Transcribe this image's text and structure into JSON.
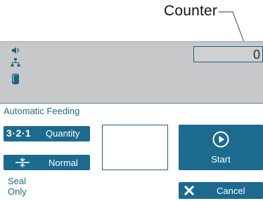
{
  "callout": {
    "label": "Counter"
  },
  "status_bar": {
    "icons": [
      "speaker-icon",
      "network-icon",
      "cup-icon"
    ],
    "counter_value": "0"
  },
  "feeding": {
    "section_title": "Automatic Feeding",
    "quantity_icon_text": "3·2·1",
    "quantity_label": "Quantity",
    "normal_label": "Normal",
    "start_label": "Start",
    "seal_only_label": "Seal Only",
    "cancel_label": "Cancel"
  },
  "colors": {
    "button_bg": "#1c6b8e",
    "status_bar_bg": "#c7c8ca",
    "accent_text": "#1a6a8e"
  }
}
